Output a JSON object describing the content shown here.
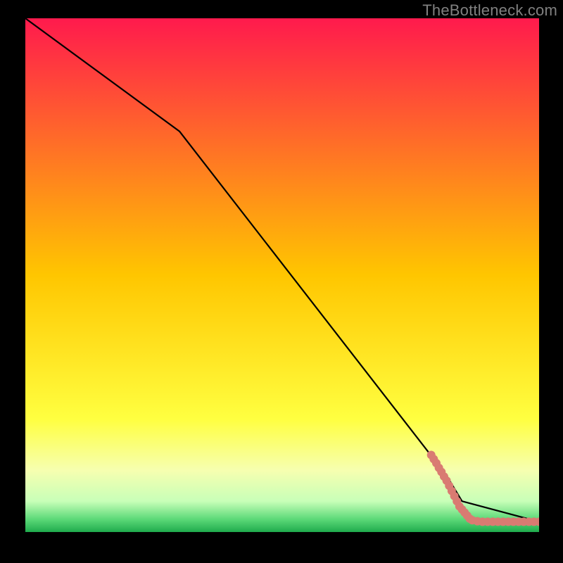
{
  "watermark": "TheBottleneck.com",
  "chart_data": {
    "type": "line",
    "title": "",
    "xlabel": "",
    "ylabel": "",
    "xlim": [
      0,
      100
    ],
    "ylim": [
      0,
      100
    ],
    "background_gradient": {
      "stops": [
        {
          "offset": 0.0,
          "color": "#ff1a4d"
        },
        {
          "offset": 0.5,
          "color": "#ffc600"
        },
        {
          "offset": 0.78,
          "color": "#ffff40"
        },
        {
          "offset": 0.88,
          "color": "#f6ffb0"
        },
        {
          "offset": 0.94,
          "color": "#c8ffb8"
        },
        {
          "offset": 0.975,
          "color": "#5cd978"
        },
        {
          "offset": 1.0,
          "color": "#1fab4d"
        }
      ]
    },
    "line": {
      "color": "#000000",
      "width": 2.2,
      "x": [
        0,
        30,
        82,
        85,
        100
      ],
      "y": [
        100,
        78,
        11,
        6,
        2
      ]
    },
    "scatter": {
      "color": "#d97b72",
      "radius": 6,
      "points": [
        {
          "x": 79.0,
          "y": 15.0
        },
        {
          "x": 79.5,
          "y": 14.2
        },
        {
          "x": 80.0,
          "y": 13.4
        },
        {
          "x": 80.5,
          "y": 12.5
        },
        {
          "x": 81.0,
          "y": 11.7
        },
        {
          "x": 81.5,
          "y": 10.8
        },
        {
          "x": 82.0,
          "y": 10.0
        },
        {
          "x": 82.5,
          "y": 9.0
        },
        {
          "x": 83.0,
          "y": 8.0
        },
        {
          "x": 83.5,
          "y": 7.0
        },
        {
          "x": 84.0,
          "y": 6.0
        },
        {
          "x": 84.5,
          "y": 5.0
        },
        {
          "x": 85.0,
          "y": 4.4
        },
        {
          "x": 85.5,
          "y": 3.8
        },
        {
          "x": 86.0,
          "y": 3.2
        },
        {
          "x": 86.5,
          "y": 2.6
        },
        {
          "x": 87.0,
          "y": 2.3
        },
        {
          "x": 88.0,
          "y": 2.1
        },
        {
          "x": 89.0,
          "y": 2.0
        },
        {
          "x": 90.0,
          "y": 2.0
        },
        {
          "x": 91.0,
          "y": 2.0
        },
        {
          "x": 92.0,
          "y": 2.0
        },
        {
          "x": 93.0,
          "y": 2.0
        },
        {
          "x": 94.0,
          "y": 2.0
        },
        {
          "x": 95.0,
          "y": 2.0
        },
        {
          "x": 96.0,
          "y": 2.0
        },
        {
          "x": 97.0,
          "y": 2.0
        },
        {
          "x": 98.0,
          "y": 2.0
        },
        {
          "x": 99.0,
          "y": 2.0
        },
        {
          "x": 100.0,
          "y": 2.0
        }
      ]
    }
  }
}
